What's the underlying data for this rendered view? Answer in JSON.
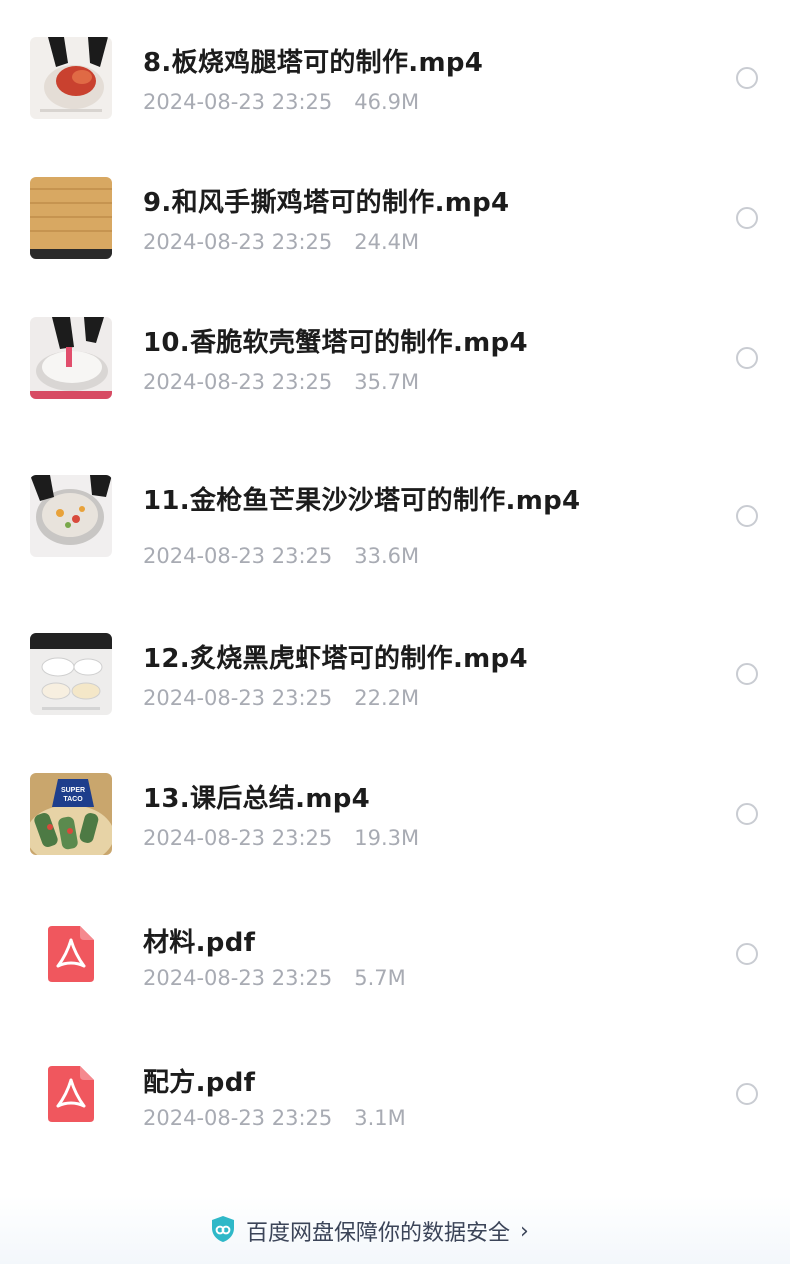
{
  "files": [
    {
      "name": "8.板烧鸡腿塔可的制作.mp4",
      "date": "2024-08-23 23:25",
      "size": "46.9M",
      "type": "video"
    },
    {
      "name": "9.和风手撕鸡塔可的制作.mp4",
      "date": "2024-08-23 23:25",
      "size": "24.4M",
      "type": "video"
    },
    {
      "name": "10.香脆软壳蟹塔可的制作.mp4",
      "date": "2024-08-23 23:25",
      "size": "35.7M",
      "type": "video"
    },
    {
      "name": "11.金枪鱼芒果沙沙塔可的制作.mp4",
      "date": "2024-08-23 23:25",
      "size": "33.6M",
      "type": "video"
    },
    {
      "name": "12.炙烧黑虎虾塔可的制作.mp4",
      "date": "2024-08-23 23:25",
      "size": "22.2M",
      "type": "video"
    },
    {
      "name": "13.课后总结.mp4",
      "date": "2024-08-23 23:25",
      "size": "19.3M",
      "type": "video",
      "thumb_text": [
        "SUPER",
        "TACO"
      ]
    },
    {
      "name": "材料.pdf",
      "date": "2024-08-23 23:25",
      "size": "5.7M",
      "type": "pdf"
    },
    {
      "name": "配方.pdf",
      "date": "2024-08-23 23:25",
      "size": "3.1M",
      "type": "pdf"
    }
  ],
  "footer": {
    "text": "百度网盘保障你的数据安全",
    "icon": "shield-icon",
    "chevron": "›"
  },
  "colors": {
    "name": "#1c1c1c",
    "meta": "#a8abb3",
    "pdf": "#f0575e",
    "shield": "#2fb8c8"
  }
}
